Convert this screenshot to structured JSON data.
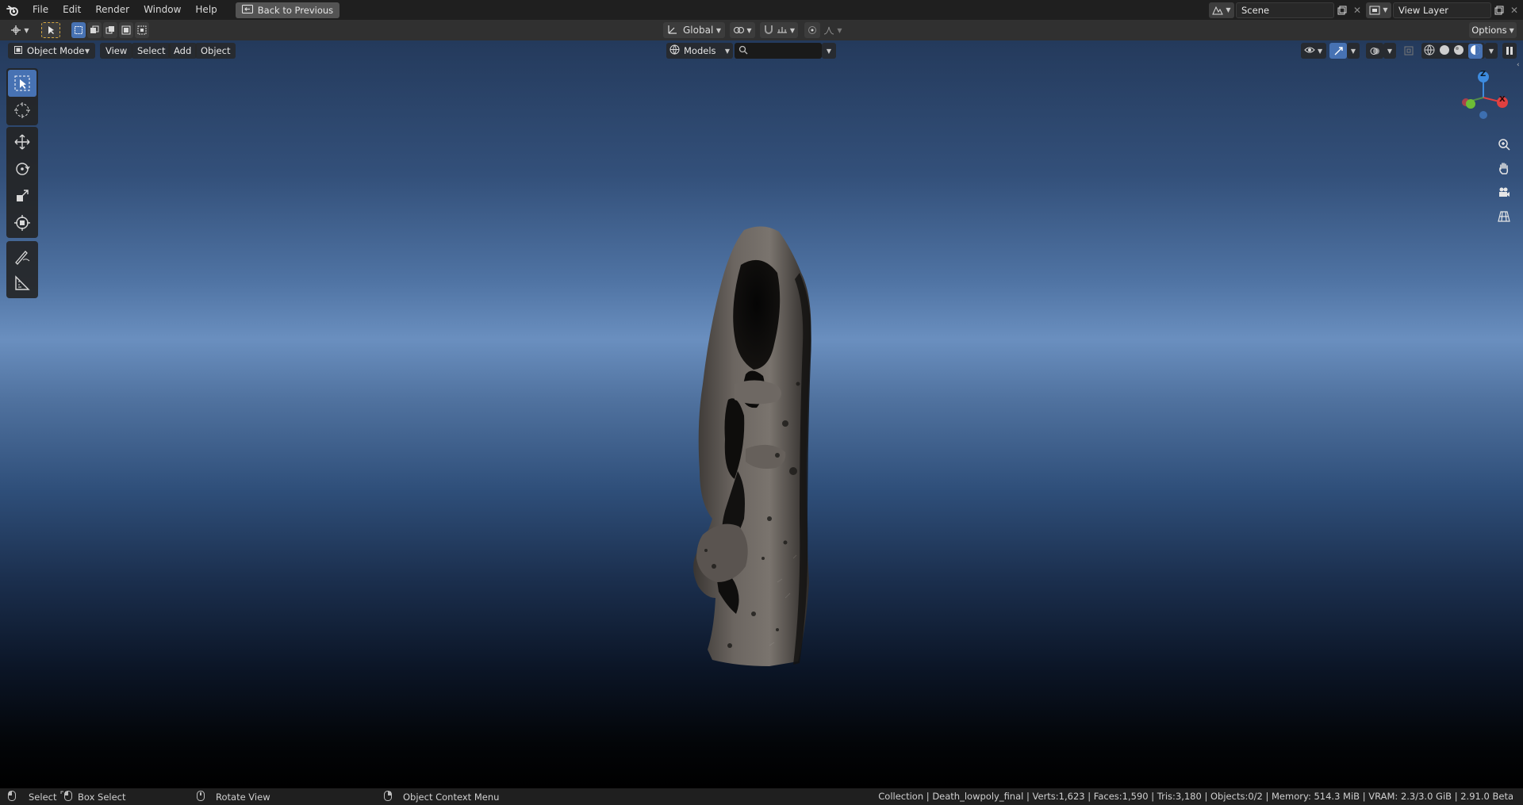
{
  "topbar": {
    "menus": [
      "File",
      "Edit",
      "Render",
      "Window",
      "Help"
    ],
    "back_button": "Back to Previous",
    "scene_name": "Scene",
    "view_layer": "View Layer"
  },
  "toolheader": {
    "transform_orientation": "Global",
    "options_label": "Options"
  },
  "viewport_header": {
    "mode": "Object Mode",
    "menus": [
      "View",
      "Select",
      "Add",
      "Object"
    ],
    "asset_library": "Models",
    "search_placeholder": ""
  },
  "gizmo": {
    "z_label": "Z",
    "x_label": "X"
  },
  "statusbar": {
    "select": "Select",
    "box_select": "Box Select",
    "rotate_view": "Rotate View",
    "context_menu": "Object Context Menu",
    "info": "Collection | Death_lowpoly_final | Verts:1,623 | Faces:1,590 | Tris:3,180 | Objects:0/2 | Memory: 514.3 MiB | VRAM: 2.3/3.0 GiB | 2.91.0 Beta"
  },
  "colors": {
    "accent": "#4772b3",
    "axis_x": "#e04040",
    "axis_y": "#6dbd36",
    "axis_z": "#3d8bdf"
  }
}
